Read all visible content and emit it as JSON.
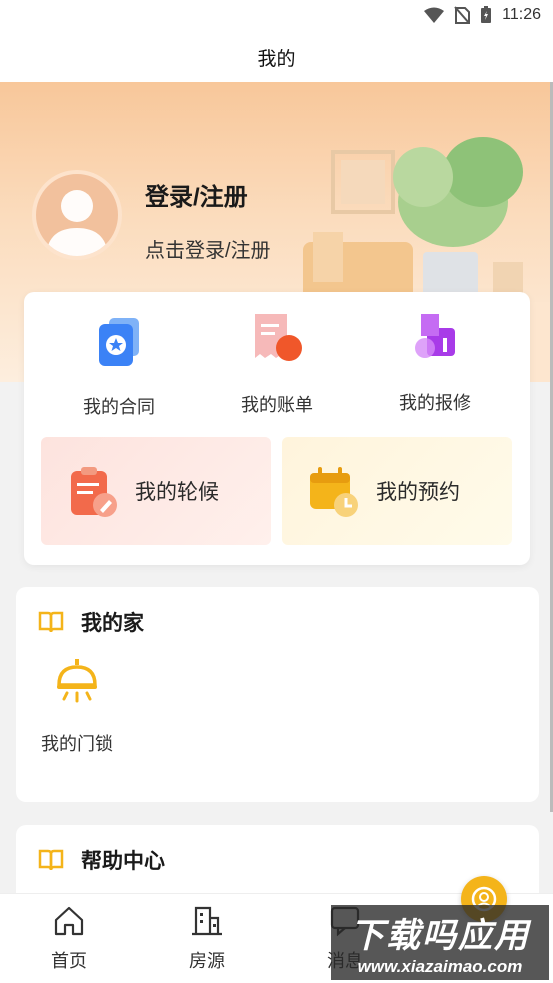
{
  "status_bar": {
    "time": "11:26"
  },
  "nav": {
    "title": "我的"
  },
  "profile": {
    "login_title": "登录/注册",
    "login_subtitle": "点击登录/注册"
  },
  "quick_actions": [
    {
      "label": "我的合同",
      "icon": "contract-star-icon"
    },
    {
      "label": "我的账单",
      "icon": "bill-icon"
    },
    {
      "label": "我的报修",
      "icon": "repair-icon"
    }
  ],
  "tiles": {
    "waitlist": {
      "label": "我的轮候",
      "icon": "clipboard-edit-icon"
    },
    "booking": {
      "label": "我的预约",
      "icon": "calendar-clock-icon"
    }
  },
  "home_section": {
    "title": "我的家",
    "items": [
      {
        "label": "我的门锁",
        "icon": "lock-lamp-icon"
      }
    ]
  },
  "help_section": {
    "title": "帮助中心"
  },
  "tabs": [
    {
      "label": "首页",
      "icon": "home-icon"
    },
    {
      "label": "房源",
      "icon": "building-icon"
    },
    {
      "label": "消息",
      "icon": "message-icon"
    }
  ],
  "watermark": {
    "main": "下载吗应用",
    "url": "www.xiazaimao.com"
  },
  "colors": {
    "accent": "#f4b41a",
    "hero_top": "#f8c79a",
    "contract": "#3b82f6",
    "bill": "#f0572a",
    "repair": "#a83be8"
  }
}
